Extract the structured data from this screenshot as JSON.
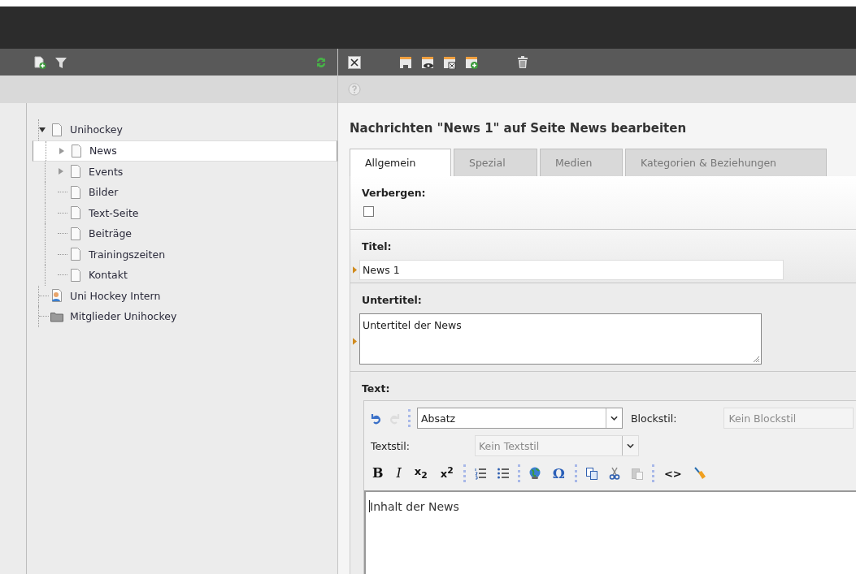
{
  "tree_panel": {
    "items": [
      {
        "label": "Unihockey",
        "kind": "page",
        "expandable": true,
        "expanded": true,
        "selected": false,
        "children": [
          {
            "label": "News",
            "kind": "page",
            "expandable": true,
            "expanded": false,
            "selected": true
          },
          {
            "label": "Events",
            "kind": "page",
            "expandable": true,
            "expanded": false,
            "selected": false
          },
          {
            "label": "Bilder",
            "kind": "page",
            "expandable": false,
            "selected": false
          },
          {
            "label": "Text-Seite",
            "kind": "page",
            "expandable": false,
            "selected": false
          },
          {
            "label": "Beiträge",
            "kind": "page",
            "expandable": false,
            "selected": false
          },
          {
            "label": "Trainingszeiten",
            "kind": "page",
            "expandable": false,
            "selected": false
          },
          {
            "label": "Kontakt",
            "kind": "page",
            "expandable": false,
            "selected": false
          }
        ]
      },
      {
        "label": "Uni Hockey Intern",
        "kind": "user-page",
        "expandable": false,
        "selected": false
      },
      {
        "label": "Mitglieder Unihockey",
        "kind": "folder",
        "expandable": false,
        "selected": false
      }
    ]
  },
  "editor": {
    "title": "Nachrichten \"News 1\" auf Seite News bearbeiten",
    "tabs": [
      {
        "label": "Allgemein",
        "selected": true
      },
      {
        "label": "Spezial",
        "selected": false
      },
      {
        "label": "Medien",
        "selected": false
      },
      {
        "label": "Kategorien & Beziehungen",
        "selected": false
      }
    ],
    "fields": [
      {
        "kind": "checkbox",
        "label": "Verbergen:",
        "checked": false,
        "marked": false
      },
      {
        "kind": "text",
        "label": "Titel:",
        "value": "News 1",
        "marked": true
      },
      {
        "kind": "textarea",
        "label": "Untertitel:",
        "value": "Untertitel der News",
        "marked": true
      },
      {
        "kind": "richtext",
        "label": "Text:",
        "marked": false,
        "history_buttons": [
          {
            "kind": "undo",
            "disabled": false
          },
          {
            "kind": "redo",
            "disabled": true
          }
        ],
        "format": {
          "value": "Absatz"
        },
        "block_style": {
          "label": "Blockstil:",
          "placeholder": "Kein Blockstil"
        },
        "text_style": {
          "label": "Textstil:",
          "placeholder": "Kein Textstil"
        },
        "buttons": [
          {
            "kind": "bold",
            "label": "B",
            "disabled": false
          },
          {
            "kind": "italic",
            "label": "I",
            "disabled": false
          },
          {
            "kind": "subscript",
            "label": "x$_{2}$",
            "disabled": false
          },
          {
            "kind": "superscript",
            "label": "x$^{2}$",
            "disabled": false
          },
          {
            "kind": "separator"
          },
          {
            "kind": "ordered-list",
            "disabled": false
          },
          {
            "kind": "bullet-list",
            "disabled": false
          },
          {
            "kind": "separator"
          },
          {
            "kind": "link",
            "disabled": false
          },
          {
            "kind": "symbol",
            "label": "Ω",
            "disabled": false
          },
          {
            "kind": "separator"
          },
          {
            "kind": "copy",
            "disabled": false
          },
          {
            "kind": "cut",
            "disabled": false
          },
          {
            "kind": "paste",
            "disabled": true
          },
          {
            "kind": "separator"
          },
          {
            "kind": "source",
            "label": "<>",
            "disabled": false
          },
          {
            "kind": "clean",
            "disabled": false
          }
        ],
        "value": "Inhalt der News"
      }
    ]
  }
}
